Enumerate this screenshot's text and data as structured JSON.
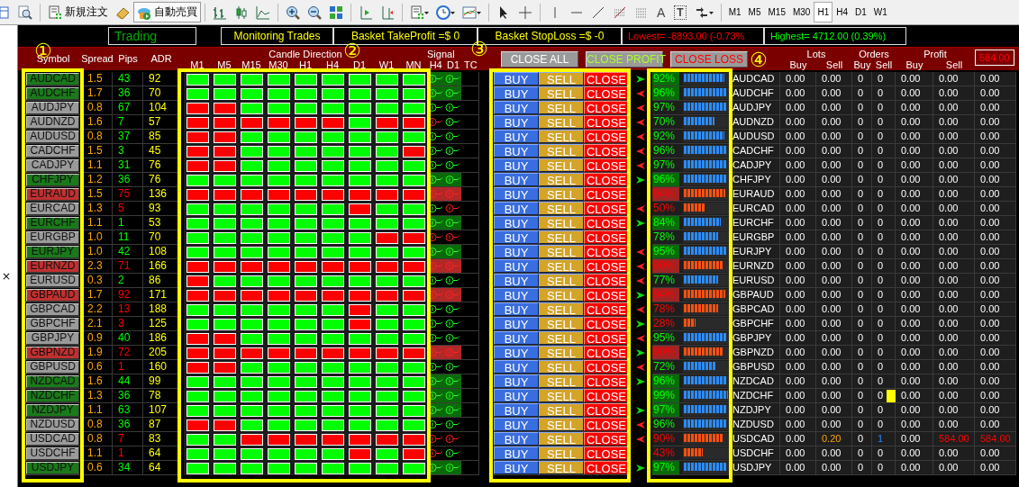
{
  "toolbar": {
    "buttons": [
      {
        "label": "新規注文",
        "selected": false
      },
      {
        "label": "自動売買",
        "selected": true
      }
    ],
    "text_tools": [
      "A",
      "T"
    ],
    "timeframes": [
      {
        "label": "M1",
        "selected": false
      },
      {
        "label": "M5",
        "selected": false
      },
      {
        "label": "M15",
        "selected": false
      },
      {
        "label": "M30",
        "selected": false
      },
      {
        "label": "H1",
        "selected": true
      },
      {
        "label": "H4",
        "selected": false
      },
      {
        "label": "D1",
        "selected": false
      },
      {
        "label": "W1",
        "selected": false
      }
    ]
  },
  "navigator": {
    "close_glyph": "×"
  },
  "status": [
    {
      "kind": "mode",
      "text": "Trading"
    },
    {
      "kind": "plain",
      "text": "Monitoring Trades"
    },
    {
      "kind": "plain",
      "text": "Basket TakeProfit =$ 0"
    },
    {
      "kind": "plain",
      "text": "Basket StopLoss =$ -0"
    },
    {
      "kind": "low",
      "text": "Lowest= -8893.00 (-0.73%"
    },
    {
      "kind": "high",
      "text": "Highest= 4712.00 (0.39%)"
    }
  ],
  "header": {
    "symbol": "Symbol",
    "spread": "Spread",
    "pips": "Pips",
    "adr": "ADR",
    "candle_title": "Candle Direction",
    "candle_timeframes": [
      "M1",
      "M5",
      "M15",
      "M30",
      "H1",
      "H4",
      "D1",
      "W1",
      "MN"
    ],
    "signal_title": "Signal",
    "signal_columns": [
      "H4",
      "D1",
      "TC"
    ],
    "actions": [
      {
        "kind": "all",
        "label": "CLOSE ALL"
      },
      {
        "kind": "profit",
        "label": "CLOSE PROFIT"
      },
      {
        "kind": "loss",
        "label": "CLOSE LOSS"
      }
    ],
    "groups": [
      {
        "title": "Lots",
        "columns": [
          "Buy",
          "Sell"
        ]
      },
      {
        "title": "Orders",
        "columns": [
          "Buy",
          "Sell"
        ]
      },
      {
        "title": "Profit",
        "columns": [
          "Buy",
          "Sell"
        ]
      }
    ],
    "total": "584.00"
  },
  "rows": [
    {
      "symbol": "AUDCAD",
      "color": "#1a7a1a",
      "spread": "1.5",
      "pips": "43",
      "pips_up": true,
      "adr": "92",
      "candles_up": [
        true,
        true,
        true,
        true,
        true,
        true,
        true,
        true,
        true
      ],
      "signals": [
        {
          "up": true,
          "strong": true
        },
        {
          "up": true,
          "strong": true
        }
      ],
      "buy": "BUY",
      "sell": "SELL",
      "close": "CLOSE",
      "arrow_buy": true,
      "arrow_sell": false,
      "strength": {
        "value": "92%",
        "level": 0.92,
        "up": true,
        "highlight": true
      },
      "summary_symbol": "AUDCAD",
      "lots": [
        "0.00",
        "0.00"
      ],
      "orders": [
        "0",
        "0"
      ],
      "profit": [
        "0.00",
        "0.00"
      ],
      "total": "0.00",
      "open_sell": false,
      "marker": false
    },
    {
      "symbol": "AUDCHF",
      "color": "#1a7a1a",
      "spread": "1.7",
      "pips": "36",
      "pips_up": true,
      "adr": "70",
      "candles_up": [
        true,
        true,
        true,
        true,
        true,
        true,
        true,
        true,
        true
      ],
      "signals": [
        {
          "up": true,
          "strong": true
        },
        {
          "up": true,
          "strong": true
        }
      ],
      "buy": "BUY",
      "sell": "SELL",
      "close": "CLOSE",
      "arrow_buy": false,
      "arrow_sell": true,
      "strength": {
        "value": "96%",
        "level": 0.96,
        "up": true,
        "highlight": true
      },
      "summary_symbol": "AUDCHF",
      "lots": [
        "0.00",
        "0.00"
      ],
      "orders": [
        "0",
        "0"
      ],
      "profit": [
        "0.00",
        "0.00"
      ],
      "total": "0.00",
      "open_sell": false,
      "marker": false
    },
    {
      "symbol": "AUDJPY",
      "color": "#9a9a9a",
      "spread": "0.8",
      "pips": "67",
      "pips_up": true,
      "adr": "104",
      "candles_up": [
        false,
        false,
        true,
        true,
        true,
        true,
        true,
        true,
        true
      ],
      "signals": [
        {
          "up": true,
          "strong": false
        },
        {
          "up": true,
          "strong": false
        }
      ],
      "buy": "BUY",
      "sell": "SELL",
      "close": "CLOSE",
      "arrow_buy": false,
      "arrow_sell": true,
      "strength": {
        "value": "97%",
        "level": 0.97,
        "up": true,
        "highlight": false
      },
      "summary_symbol": "AUDJPY",
      "lots": [
        "0.00",
        "0.00"
      ],
      "orders": [
        "0",
        "0"
      ],
      "profit": [
        "0.00",
        "0.00"
      ],
      "total": "0.00",
      "open_sell": false,
      "marker": false
    },
    {
      "symbol": "AUDNZD",
      "color": "#9a9a9a",
      "spread": "1.6",
      "pips": "7",
      "pips_up": true,
      "adr": "57",
      "candles_up": [
        false,
        false,
        false,
        false,
        false,
        false,
        true,
        false,
        false
      ],
      "signals": [
        {
          "up": false,
          "strong": false
        },
        {
          "up": true,
          "strong": false
        }
      ],
      "buy": "BUY",
      "sell": "SELL",
      "close": "CLOSE",
      "arrow_buy": false,
      "arrow_sell": true,
      "strength": {
        "value": "70%",
        "level": 0.7,
        "up": true,
        "highlight": false
      },
      "summary_symbol": "AUDNZD",
      "lots": [
        "0.00",
        "0.00"
      ],
      "orders": [
        "0",
        "0"
      ],
      "profit": [
        "0.00",
        "0.00"
      ],
      "total": "0.00",
      "open_sell": false,
      "marker": false
    },
    {
      "symbol": "AUDUSD",
      "color": "#9a9a9a",
      "spread": "0.8",
      "pips": "37",
      "pips_up": true,
      "adr": "85",
      "candles_up": [
        false,
        false,
        true,
        true,
        true,
        true,
        true,
        true,
        true
      ],
      "signals": [
        {
          "up": true,
          "strong": false
        },
        {
          "up": true,
          "strong": false
        }
      ],
      "buy": "BUY",
      "sell": "SELL",
      "close": "CLOSE",
      "arrow_buy": false,
      "arrow_sell": true,
      "strength": {
        "value": "92%",
        "level": 0.92,
        "up": true,
        "highlight": false
      },
      "summary_symbol": "AUDUSD",
      "lots": [
        "0.00",
        "0.00"
      ],
      "orders": [
        "0",
        "0"
      ],
      "profit": [
        "0.00",
        "0.00"
      ],
      "total": "0.00",
      "open_sell": false,
      "marker": false
    },
    {
      "symbol": "CADCHF",
      "color": "#9a9a9a",
      "spread": "1.5",
      "pips": "3",
      "pips_up": true,
      "adr": "45",
      "candles_up": [
        false,
        false,
        true,
        true,
        true,
        true,
        true,
        true,
        false
      ],
      "signals": [
        {
          "up": true,
          "strong": false
        },
        {
          "up": true,
          "strong": false
        }
      ],
      "buy": "BUY",
      "sell": "SELL",
      "close": "CLOSE",
      "arrow_buy": false,
      "arrow_sell": true,
      "strength": {
        "value": "96%",
        "level": 0.96,
        "up": true,
        "highlight": false
      },
      "summary_symbol": "CADCHF",
      "lots": [
        "0.00",
        "0.00"
      ],
      "orders": [
        "0",
        "0"
      ],
      "profit": [
        "0.00",
        "0.00"
      ],
      "total": "0.00",
      "open_sell": false,
      "marker": false
    },
    {
      "symbol": "CADJPY",
      "color": "#9a9a9a",
      "spread": "1.1",
      "pips": "31",
      "pips_up": true,
      "adr": "76",
      "candles_up": [
        false,
        false,
        true,
        true,
        true,
        true,
        true,
        true,
        true
      ],
      "signals": [
        {
          "up": true,
          "strong": false
        },
        {
          "up": true,
          "strong": false
        }
      ],
      "buy": "BUY",
      "sell": "SELL",
      "close": "CLOSE",
      "arrow_buy": false,
      "arrow_sell": true,
      "strength": {
        "value": "97%",
        "level": 0.97,
        "up": true,
        "highlight": false
      },
      "summary_symbol": "CADJPY",
      "lots": [
        "0.00",
        "0.00"
      ],
      "orders": [
        "0",
        "0"
      ],
      "profit": [
        "0.00",
        "0.00"
      ],
      "total": "0.00",
      "open_sell": false,
      "marker": false
    },
    {
      "symbol": "CHFJPY",
      "color": "#1a7a1a",
      "spread": "1.2",
      "pips": "36",
      "pips_up": true,
      "adr": "76",
      "candles_up": [
        true,
        true,
        true,
        true,
        true,
        true,
        true,
        true,
        true
      ],
      "signals": [
        {
          "up": true,
          "strong": true
        },
        {
          "up": true,
          "strong": true
        }
      ],
      "buy": "BUY",
      "sell": "SELL",
      "close": "CLOSE",
      "arrow_buy": true,
      "arrow_sell": false,
      "strength": {
        "value": "96%",
        "level": 0.96,
        "up": true,
        "highlight": true
      },
      "summary_symbol": "CHFJPY",
      "lots": [
        "0.00",
        "0.00"
      ],
      "orders": [
        "0",
        "0"
      ],
      "profit": [
        "0.00",
        "0.00"
      ],
      "total": "0.00",
      "open_sell": false,
      "marker": false
    },
    {
      "symbol": "EURAUD",
      "color": "#c03030",
      "spread": "1.5",
      "pips": "75",
      "pips_up": false,
      "adr": "136",
      "candles_up": [
        false,
        false,
        false,
        false,
        false,
        false,
        false,
        false,
        false
      ],
      "signals": [
        {
          "up": false,
          "strong": true
        },
        {
          "up": false,
          "strong": true
        }
      ],
      "buy": "BUY",
      "sell": "SELL",
      "close": "CLOSE",
      "arrow_buy": false,
      "arrow_sell": false,
      "strength": {
        "value": "94%",
        "level": 0.94,
        "up": false,
        "highlight": true
      },
      "summary_symbol": "EURAUD",
      "lots": [
        "0.00",
        "0.00"
      ],
      "orders": [
        "0",
        "0"
      ],
      "profit": [
        "0.00",
        "0.00"
      ],
      "total": "0.00",
      "open_sell": false,
      "marker": false
    },
    {
      "symbol": "EURCAD",
      "color": "#9a9a9a",
      "spread": "1.3",
      "pips": "5",
      "pips_up": false,
      "adr": "93",
      "candles_up": [
        true,
        true,
        true,
        true,
        true,
        true,
        false,
        true,
        true
      ],
      "signals": [
        {
          "up": true,
          "strong": false
        },
        {
          "up": false,
          "strong": false
        }
      ],
      "buy": "BUY",
      "sell": "SELL",
      "close": "CLOSE",
      "arrow_buy": false,
      "arrow_sell": true,
      "strength": {
        "value": "50%",
        "level": 0.5,
        "up": false,
        "highlight": false
      },
      "summary_symbol": "EURCAD",
      "lots": [
        "0.00",
        "0.00"
      ],
      "orders": [
        "0",
        "0"
      ],
      "profit": [
        "0.00",
        "0.00"
      ],
      "total": "0.00",
      "open_sell": false,
      "marker": false
    },
    {
      "symbol": "EURCHF",
      "color": "#1a7a1a",
      "spread": "1.1",
      "pips": "1",
      "pips_up": true,
      "adr": "53",
      "candles_up": [
        true,
        true,
        true,
        true,
        true,
        true,
        true,
        true,
        true
      ],
      "signals": [
        {
          "up": true,
          "strong": true
        },
        {
          "up": true,
          "strong": true
        }
      ],
      "buy": "BUY",
      "sell": "SELL",
      "close": "CLOSE",
      "arrow_buy": true,
      "arrow_sell": false,
      "strength": {
        "value": "84%",
        "level": 0.84,
        "up": true,
        "highlight": true
      },
      "summary_symbol": "EURCHF",
      "lots": [
        "0.00",
        "0.00"
      ],
      "orders": [
        "0",
        "0"
      ],
      "profit": [
        "0.00",
        "0.00"
      ],
      "total": "0.00",
      "open_sell": false,
      "marker": false
    },
    {
      "symbol": "EURGBP",
      "color": "#9a9a9a",
      "spread": "1.0",
      "pips": "11",
      "pips_up": true,
      "adr": "70",
      "candles_up": [
        true,
        true,
        true,
        true,
        true,
        true,
        true,
        false,
        false
      ],
      "signals": [
        {
          "up": false,
          "strong": false
        },
        {
          "up": false,
          "strong": false
        }
      ],
      "buy": "BUY",
      "sell": "SELL",
      "close": "CLOSE",
      "arrow_buy": false,
      "arrow_sell": false,
      "strength": {
        "value": "78%",
        "level": 0.78,
        "up": true,
        "highlight": false
      },
      "summary_symbol": "EURGBP",
      "lots": [
        "0.00",
        "0.00"
      ],
      "orders": [
        "0",
        "0"
      ],
      "profit": [
        "0.00",
        "0.00"
      ],
      "total": "0.00",
      "open_sell": false,
      "marker": false
    },
    {
      "symbol": "EURJPY",
      "color": "#1a7a1a",
      "spread": "1.0",
      "pips": "42",
      "pips_up": true,
      "adr": "108",
      "candles_up": [
        true,
        true,
        true,
        true,
        true,
        true,
        true,
        true,
        true
      ],
      "signals": [
        {
          "up": true,
          "strong": true
        },
        {
          "up": true,
          "strong": true
        }
      ],
      "buy": "BUY",
      "sell": "SELL",
      "close": "CLOSE",
      "arrow_buy": false,
      "arrow_sell": true,
      "strength": {
        "value": "95%",
        "level": 0.95,
        "up": true,
        "highlight": true
      },
      "summary_symbol": "EURJPY",
      "lots": [
        "0.00",
        "0.00"
      ],
      "orders": [
        "0",
        "0"
      ],
      "profit": [
        "0.00",
        "0.00"
      ],
      "total": "0.00",
      "open_sell": false,
      "marker": false
    },
    {
      "symbol": "EURNZD",
      "color": "#c03030",
      "spread": "2.3",
      "pips": "71",
      "pips_up": false,
      "adr": "166",
      "candles_up": [
        false,
        false,
        false,
        false,
        false,
        false,
        false,
        false,
        false
      ],
      "signals": [
        {
          "up": false,
          "strong": true
        },
        {
          "up": false,
          "strong": true
        }
      ],
      "buy": "BUY",
      "sell": "SELL",
      "close": "CLOSE",
      "arrow_buy": false,
      "arrow_sell": true,
      "strength": {
        "value": "90%",
        "level": 0.9,
        "up": false,
        "highlight": true
      },
      "summary_symbol": "EURNZD",
      "lots": [
        "0.00",
        "0.00"
      ],
      "orders": [
        "0",
        "0"
      ],
      "profit": [
        "0.00",
        "0.00"
      ],
      "total": "0.00",
      "open_sell": false,
      "marker": false
    },
    {
      "symbol": "EURUSD",
      "color": "#9a9a9a",
      "spread": "0.3",
      "pips": "2",
      "pips_up": true,
      "adr": "86",
      "candles_up": [
        false,
        true,
        true,
        true,
        true,
        true,
        true,
        true,
        true
      ],
      "signals": [
        {
          "up": true,
          "strong": false
        },
        {
          "up": true,
          "strong": false
        }
      ],
      "buy": "BUY",
      "sell": "SELL",
      "close": "CLOSE",
      "arrow_buy": false,
      "arrow_sell": true,
      "strength": {
        "value": "77%",
        "level": 0.77,
        "up": true,
        "highlight": false
      },
      "summary_symbol": "EURUSD",
      "lots": [
        "0.00",
        "0.00"
      ],
      "orders": [
        "0",
        "0"
      ],
      "profit": [
        "0.00",
        "0.00"
      ],
      "total": "0.00",
      "open_sell": false,
      "marker": false
    },
    {
      "symbol": "GBPAUD",
      "color": "#c03030",
      "spread": "1.7",
      "pips": "92",
      "pips_up": false,
      "adr": "171",
      "candles_up": [
        false,
        false,
        false,
        false,
        false,
        false,
        false,
        false,
        false
      ],
      "signals": [
        {
          "up": false,
          "strong": true
        },
        {
          "up": false,
          "strong": true
        }
      ],
      "buy": "BUY",
      "sell": "SELL",
      "close": "CLOSE",
      "arrow_buy": true,
      "arrow_sell": false,
      "strength": {
        "value": "94%",
        "level": 0.94,
        "up": false,
        "highlight": true
      },
      "summary_symbol": "GBPAUD",
      "lots": [
        "0.00",
        "0.00"
      ],
      "orders": [
        "0",
        "0"
      ],
      "profit": [
        "0.00",
        "0.00"
      ],
      "total": "0.00",
      "open_sell": false,
      "marker": false
    },
    {
      "symbol": "GBPCAD",
      "color": "#9a9a9a",
      "spread": "2.2",
      "pips": "13",
      "pips_up": false,
      "adr": "188",
      "candles_up": [
        true,
        true,
        true,
        true,
        true,
        true,
        false,
        true,
        true
      ],
      "signals": [
        {
          "up": true,
          "strong": false
        },
        {
          "up": true,
          "strong": false
        }
      ],
      "buy": "BUY",
      "sell": "SELL",
      "close": "CLOSE",
      "arrow_buy": false,
      "arrow_sell": true,
      "strength": {
        "value": "78%",
        "level": 0.78,
        "up": false,
        "highlight": false
      },
      "summary_symbol": "GBPCAD",
      "lots": [
        "0.00",
        "0.00"
      ],
      "orders": [
        "0",
        "0"
      ],
      "profit": [
        "0.00",
        "0.00"
      ],
      "total": "0.00",
      "open_sell": false,
      "marker": false
    },
    {
      "symbol": "GBPCHF",
      "color": "#9a9a9a",
      "spread": "2.1",
      "pips": "3",
      "pips_up": false,
      "adr": "125",
      "candles_up": [
        true,
        true,
        true,
        true,
        true,
        true,
        false,
        true,
        true
      ],
      "signals": [
        {
          "up": true,
          "strong": false
        },
        {
          "up": true,
          "strong": false
        }
      ],
      "buy": "BUY",
      "sell": "SELL",
      "close": "CLOSE",
      "arrow_buy": true,
      "arrow_sell": false,
      "strength": {
        "value": "28%",
        "level": 0.28,
        "up": false,
        "highlight": false
      },
      "summary_symbol": "GBPCHF",
      "lots": [
        "0.00",
        "0.00"
      ],
      "orders": [
        "0",
        "0"
      ],
      "profit": [
        "0.00",
        "0.00"
      ],
      "total": "0.00",
      "open_sell": false,
      "marker": false
    },
    {
      "symbol": "GBPJPY",
      "color": "#9a9a9a",
      "spread": "0.9",
      "pips": "40",
      "pips_up": true,
      "adr": "186",
      "candles_up": [
        false,
        false,
        true,
        true,
        true,
        true,
        true,
        true,
        true
      ],
      "signals": [
        {
          "up": true,
          "strong": false
        },
        {
          "up": true,
          "strong": false
        }
      ],
      "buy": "BUY",
      "sell": "SELL",
      "close": "CLOSE",
      "arrow_buy": false,
      "arrow_sell": true,
      "strength": {
        "value": "95%",
        "level": 0.95,
        "up": true,
        "highlight": false
      },
      "summary_symbol": "GBPJPY",
      "lots": [
        "0.00",
        "0.00"
      ],
      "orders": [
        "0",
        "0"
      ],
      "profit": [
        "0.00",
        "0.00"
      ],
      "total": "0.00",
      "open_sell": false,
      "marker": false
    },
    {
      "symbol": "GBPNZD",
      "color": "#c03030",
      "spread": "1.9",
      "pips": "72",
      "pips_up": false,
      "adr": "205",
      "candles_up": [
        false,
        false,
        false,
        false,
        false,
        false,
        false,
        false,
        false
      ],
      "signals": [
        {
          "up": false,
          "strong": true
        },
        {
          "up": false,
          "strong": true
        }
      ],
      "buy": "BUY",
      "sell": "SELL",
      "close": "CLOSE",
      "arrow_buy": true,
      "arrow_sell": false,
      "strength": {
        "value": "90%",
        "level": 0.9,
        "up": false,
        "highlight": true
      },
      "summary_symbol": "GBPNZD",
      "lots": [
        "0.00",
        "0.00"
      ],
      "orders": [
        "0",
        "0"
      ],
      "profit": [
        "0.00",
        "0.00"
      ],
      "total": "0.00",
      "open_sell": false,
      "marker": false
    },
    {
      "symbol": "GBPUSD",
      "color": "#9a9a9a",
      "spread": "0.6",
      "pips": "1",
      "pips_up": false,
      "adr": "160",
      "candles_up": [
        false,
        false,
        true,
        true,
        true,
        true,
        true,
        true,
        true
      ],
      "signals": [
        {
          "up": true,
          "strong": false
        },
        {
          "up": true,
          "strong": false
        }
      ],
      "buy": "BUY",
      "sell": "SELL",
      "close": "CLOSE",
      "arrow_buy": false,
      "arrow_sell": true,
      "strength": {
        "value": "72%",
        "level": 0.72,
        "up": true,
        "highlight": false
      },
      "summary_symbol": "GBPUSD",
      "lots": [
        "0.00",
        "0.00"
      ],
      "orders": [
        "0",
        "0"
      ],
      "profit": [
        "0.00",
        "0.00"
      ],
      "total": "0.00",
      "open_sell": false,
      "marker": false
    },
    {
      "symbol": "NZDCAD",
      "color": "#1a7a1a",
      "spread": "1.6",
      "pips": "44",
      "pips_up": true,
      "adr": "99",
      "candles_up": [
        true,
        true,
        true,
        true,
        true,
        true,
        true,
        true,
        true
      ],
      "signals": [
        {
          "up": true,
          "strong": true
        },
        {
          "up": true,
          "strong": true
        }
      ],
      "buy": "BUY",
      "sell": "SELL",
      "close": "CLOSE",
      "arrow_buy": true,
      "arrow_sell": false,
      "strength": {
        "value": "96%",
        "level": 0.96,
        "up": true,
        "highlight": true
      },
      "summary_symbol": "NZDCAD",
      "lots": [
        "0.00",
        "0.00"
      ],
      "orders": [
        "0",
        "0"
      ],
      "profit": [
        "0.00",
        "0.00"
      ],
      "total": "0.00",
      "open_sell": false,
      "marker": false
    },
    {
      "symbol": "NZDCHF",
      "color": "#1a7a1a",
      "spread": "1.3",
      "pips": "36",
      "pips_up": true,
      "adr": "78",
      "candles_up": [
        true,
        true,
        true,
        true,
        true,
        true,
        true,
        true,
        true
      ],
      "signals": [
        {
          "up": true,
          "strong": true
        },
        {
          "up": true,
          "strong": true
        }
      ],
      "buy": "BUY",
      "sell": "SELL",
      "close": "CLOSE",
      "arrow_buy": false,
      "arrow_sell": false,
      "strength": {
        "value": "99%",
        "level": 0.99,
        "up": true,
        "highlight": true
      },
      "summary_symbol": "NZDCHF",
      "lots": [
        "0.00",
        "0.00"
      ],
      "orders": [
        "0",
        "0"
      ],
      "profit": [
        "0.00",
        "0.00"
      ],
      "total": "0.00",
      "open_sell": false,
      "marker": true
    },
    {
      "symbol": "NZDJPY",
      "color": "#1a7a1a",
      "spread": "1.1",
      "pips": "63",
      "pips_up": true,
      "adr": "107",
      "candles_up": [
        true,
        true,
        true,
        true,
        true,
        true,
        true,
        true,
        true
      ],
      "signals": [
        {
          "up": true,
          "strong": true
        },
        {
          "up": true,
          "strong": true
        }
      ],
      "buy": "BUY",
      "sell": "SELL",
      "close": "CLOSE",
      "arrow_buy": true,
      "arrow_sell": false,
      "strength": {
        "value": "97%",
        "level": 0.97,
        "up": true,
        "highlight": true
      },
      "summary_symbol": "NZDJPY",
      "lots": [
        "0.00",
        "0.00"
      ],
      "orders": [
        "0",
        "0"
      ],
      "profit": [
        "0.00",
        "0.00"
      ],
      "total": "0.00",
      "open_sell": false,
      "marker": false
    },
    {
      "symbol": "NZDUSD",
      "color": "#9a9a9a",
      "spread": "0.8",
      "pips": "36",
      "pips_up": true,
      "adr": "87",
      "candles_up": [
        false,
        false,
        true,
        true,
        true,
        true,
        true,
        true,
        true
      ],
      "signals": [
        {
          "up": true,
          "strong": false
        },
        {
          "up": true,
          "strong": false
        }
      ],
      "buy": "BUY",
      "sell": "SELL",
      "close": "CLOSE",
      "arrow_buy": false,
      "arrow_sell": true,
      "strength": {
        "value": "96%",
        "level": 0.96,
        "up": true,
        "highlight": false
      },
      "summary_symbol": "NZDUSD",
      "lots": [
        "0.00",
        "0.00"
      ],
      "orders": [
        "0",
        "0"
      ],
      "profit": [
        "0.00",
        "0.00"
      ],
      "total": "0.00",
      "open_sell": false,
      "marker": false
    },
    {
      "symbol": "USDCAD",
      "color": "#9a9a9a",
      "spread": "0.8",
      "pips": "7",
      "pips_up": false,
      "adr": "83",
      "candles_up": [
        true,
        true,
        false,
        false,
        false,
        false,
        false,
        false,
        false
      ],
      "signals": [
        {
          "up": false,
          "strong": false
        },
        {
          "up": false,
          "strong": false
        }
      ],
      "buy": "BUY",
      "sell": "SELL",
      "close": "CLOSE",
      "arrow_buy": false,
      "arrow_sell": true,
      "strength": {
        "value": "90%",
        "level": 0.9,
        "up": false,
        "highlight": false
      },
      "summary_symbol": "USDCAD",
      "lots": [
        "0.00",
        "0.20"
      ],
      "orders": [
        "0",
        "1"
      ],
      "profit": [
        "0.00",
        "584.00"
      ],
      "total": "584.00",
      "open_sell": true,
      "marker": false
    },
    {
      "symbol": "USDCHF",
      "color": "#9a9a9a",
      "spread": "1.1",
      "pips": "1",
      "pips_up": false,
      "adr": "64",
      "candles_up": [
        true,
        true,
        true,
        true,
        true,
        true,
        false,
        true,
        false
      ],
      "signals": [
        {
          "up": false,
          "strong": false
        },
        {
          "up": true,
          "strong": false
        }
      ],
      "buy": "BUY",
      "sell": "SELL",
      "close": "CLOSE",
      "arrow_buy": false,
      "arrow_sell": false,
      "strength": {
        "value": "43%",
        "level": 0.43,
        "up": false,
        "highlight": false
      },
      "summary_symbol": "USDCHF",
      "lots": [
        "0.00",
        "0.00"
      ],
      "orders": [
        "0",
        "0"
      ],
      "profit": [
        "0.00",
        "0.00"
      ],
      "total": "0.00",
      "open_sell": false,
      "marker": false
    },
    {
      "symbol": "USDJPY",
      "color": "#1a7a1a",
      "spread": "0.6",
      "pips": "34",
      "pips_up": true,
      "adr": "64",
      "candles_up": [
        true,
        true,
        true,
        true,
        true,
        true,
        true,
        true,
        true
      ],
      "signals": [
        {
          "up": true,
          "strong": true
        },
        {
          "up": true,
          "strong": true
        }
      ],
      "buy": "BUY",
      "sell": "SELL",
      "close": "CLOSE",
      "arrow_buy": true,
      "arrow_sell": false,
      "strength": {
        "value": "97%",
        "level": 0.97,
        "up": true,
        "highlight": true
      },
      "summary_symbol": "USDJPY",
      "lots": [
        "0.00",
        "0.00"
      ],
      "orders": [
        "0",
        "0"
      ],
      "profit": [
        "0.00",
        "0.00"
      ],
      "total": "0.00",
      "open_sell": false,
      "marker": false
    }
  ],
  "annotations": [
    {
      "label": "①"
    },
    {
      "label": "②"
    },
    {
      "label": "③"
    },
    {
      "label": "④"
    }
  ]
}
